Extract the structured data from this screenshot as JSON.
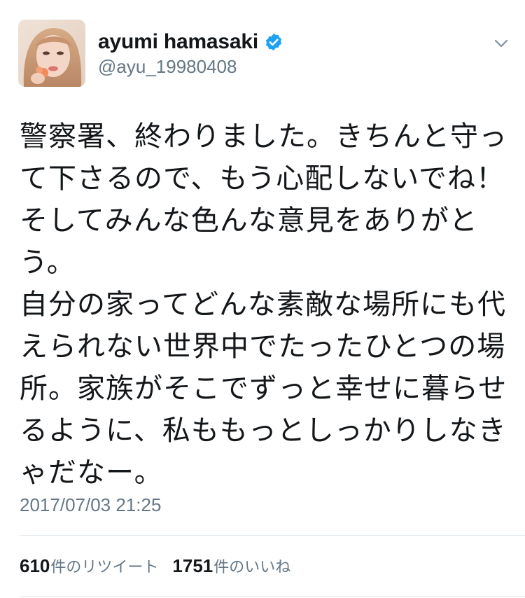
{
  "user": {
    "display_name": "ayumi hamasaki",
    "handle": "@ayu_19980408",
    "verified": true
  },
  "tweet": {
    "text": "警察署、終わりました。きちんと守って下さるので、もう心配しないでね！そしてみんな色んな意見をありがとう。\n自分の家ってどんな素敵な場所にも代えられない世界中でたったひとつの場所。家族がそこでずっと幸せに暮らせるように、私ももっとしっかりしなきゃだなー。",
    "timestamp": "2017/07/03 21:25"
  },
  "stats": {
    "retweets_count": "610",
    "retweets_label": "件のリツイート",
    "likes_count": "1751",
    "likes_label": "件のいいね"
  },
  "icons": {
    "verified": "verified-badge-icon",
    "menu": "chevron-down-icon"
  },
  "colors": {
    "verified_blue": "#1da1f2",
    "secondary_text": "#657786",
    "primary_text": "#14171a",
    "divider": "#e1e8ed"
  }
}
